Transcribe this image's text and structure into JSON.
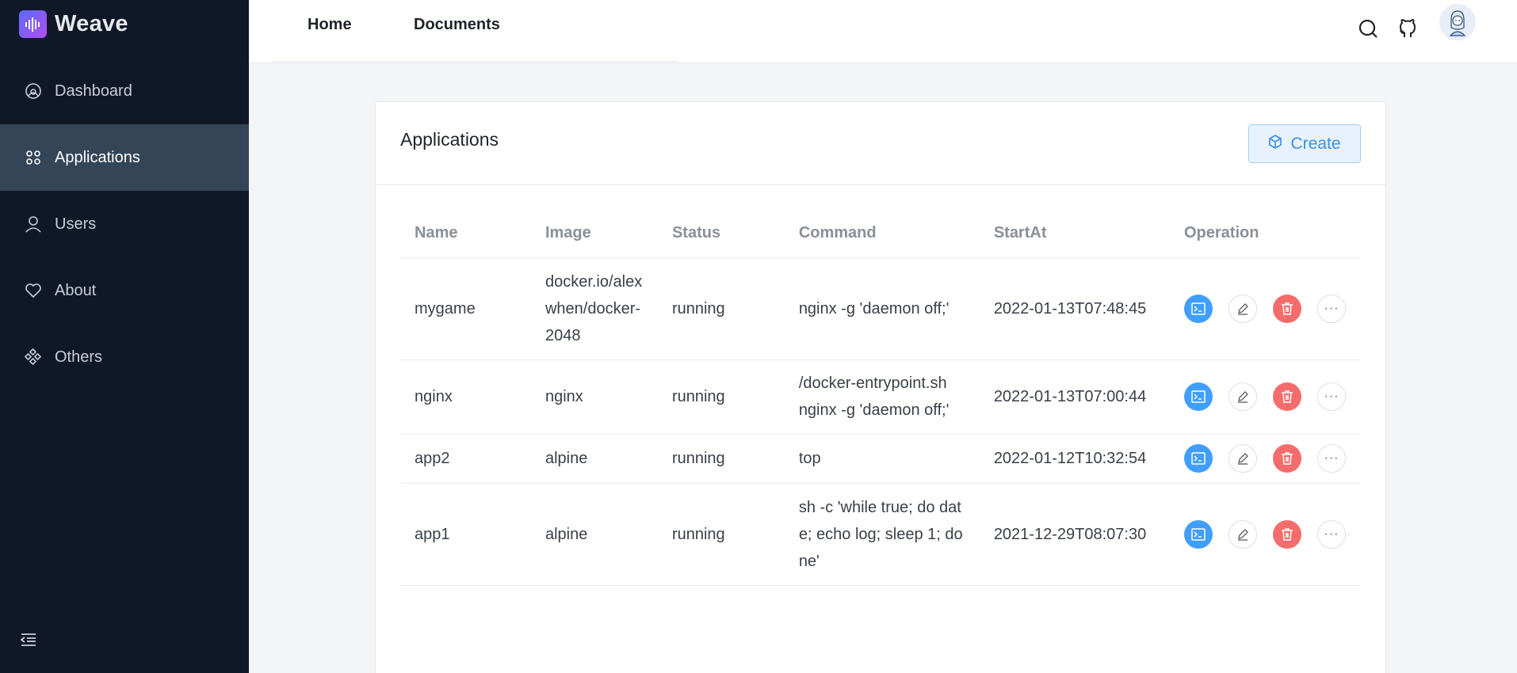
{
  "brand": {
    "name": "Weave"
  },
  "sidebar": {
    "items": [
      {
        "label": "Dashboard",
        "icon": "dashboard-icon",
        "active": false
      },
      {
        "label": "Applications",
        "icon": "applications-icon",
        "active": true
      },
      {
        "label": "Users",
        "icon": "user-icon",
        "active": false
      },
      {
        "label": "About",
        "icon": "heart-icon",
        "active": false
      },
      {
        "label": "Others",
        "icon": "others-icon",
        "active": false
      }
    ]
  },
  "header": {
    "tabs": [
      {
        "label": "Home"
      },
      {
        "label": "Documents"
      }
    ]
  },
  "card": {
    "title": "Applications",
    "create_label": "Create"
  },
  "table": {
    "columns": [
      "Name",
      "Image",
      "Status",
      "Command",
      "StartAt",
      "Operation"
    ],
    "rows": [
      {
        "name": "mygame",
        "image": "docker.io/alexwhen/docker-2048",
        "status": "running",
        "command": "nginx -g 'daemon off;'",
        "start_at": "2022-01-13T07:48:45"
      },
      {
        "name": "nginx",
        "image": "nginx",
        "status": "running",
        "command": "/docker-entrypoint.sh nginx -g 'daemon off;'",
        "start_at": "2022-01-13T07:00:44"
      },
      {
        "name": "app2",
        "image": "alpine",
        "status": "running",
        "command": "top",
        "start_at": "2022-01-12T10:32:54"
      },
      {
        "name": "app1",
        "image": "alpine",
        "status": "running",
        "command": "sh -c 'while true; do date; echo log; sleep 1; done'",
        "start_at": "2021-12-29T08:07:30"
      }
    ]
  },
  "colors": {
    "sidebar_bg": "#101828",
    "sidebar_active": "#354558",
    "primary": "#409eff",
    "danger": "#f56c6c"
  }
}
